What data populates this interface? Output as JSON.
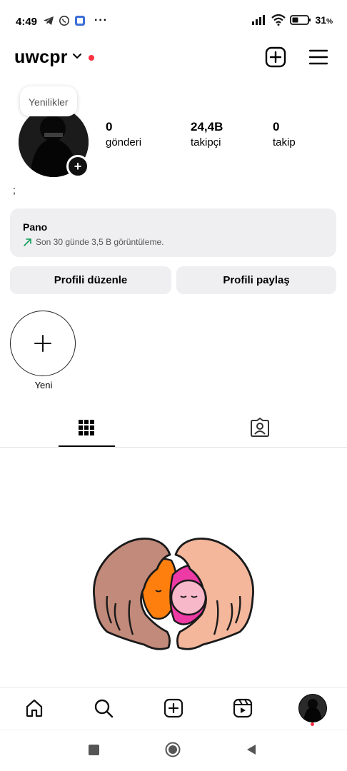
{
  "status_bar": {
    "time": "4:49",
    "battery": "31"
  },
  "header": {
    "username": "uwcpr"
  },
  "profile": {
    "note": "Yenilikler",
    "bio": ";",
    "stats": [
      {
        "value": "0",
        "label": "gönderi"
      },
      {
        "value": "24,4B",
        "label": "takipçi"
      },
      {
        "value": "0",
        "label": "takip"
      }
    ]
  },
  "dashboard": {
    "title": "Pano",
    "subtitle": "Son 30 günde 3,5 B görüntüleme."
  },
  "buttons": {
    "edit": "Profili düzenle",
    "share": "Profili paylaş"
  },
  "highlights": {
    "new_label": "Yeni"
  },
  "colors": {
    "accent_red": "#ff3040",
    "button_bg": "#efeff1",
    "trend_green": "#0f9d58"
  }
}
